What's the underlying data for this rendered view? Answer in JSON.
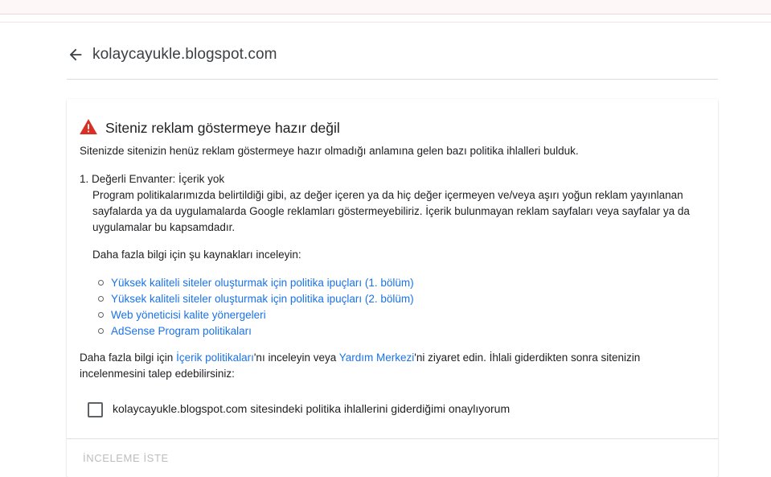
{
  "header": {
    "site": "kolaycayukle.blogspot.com"
  },
  "alert": {
    "title": "Siteniz reklam göstermeye hazır değil",
    "lead": "Sitenizde sitenizin henüz reklam göstermeye hazır olmadığı anlamına gelen bazı politika ihlalleri bulduk.",
    "warning_color": "#d93025"
  },
  "violation": {
    "title": "1. Değerli Envanter: İçerik yok",
    "description": "Program politikalarımızda belirtildiği gibi, az değer içeren ya da hiç değer içermeyen ve/veya aşırı yoğun reklam yayınlanan sayfalarda ya da uygulamalarda Google reklamları göstermeyebiliriz. İçerik bulunmayan reklam sayfaları veya sayfalar ya da uygulamalar bu kapsamdadır.",
    "more_info": "Daha fazla bilgi için şu kaynakları inceleyin:",
    "resources": [
      "Yüksek kaliteli siteler oluşturmak için politika ipuçları (1. bölüm)",
      "Yüksek kaliteli siteler oluşturmak için politika ipuçları (2. bölüm)",
      "Web yöneticisi kalite yönergeleri",
      "AdSense Program politikaları"
    ]
  },
  "footer": {
    "text_1": "Daha fazla bilgi için ",
    "link_1": "İçerik politikaları",
    "text_2": "'nı inceleyin veya ",
    "link_2": "Yardım Merkezi",
    "text_3": "'ni ziyaret edin. İhlali giderdikten sonra sitenizin incelenmesini talep edebilirsiniz:"
  },
  "confirm": {
    "label": "kolaycayukle.blogspot.com sitesindeki politika ihlallerini giderdiğimi onaylıyorum",
    "checked": false
  },
  "actions": {
    "review": "İNCELEME İSTE"
  },
  "colors": {
    "link": "#1a73e8",
    "disabled": "#bdbdbd"
  },
  "icons": {
    "back": "arrow-back-icon",
    "warning": "warning-triangle-icon"
  }
}
